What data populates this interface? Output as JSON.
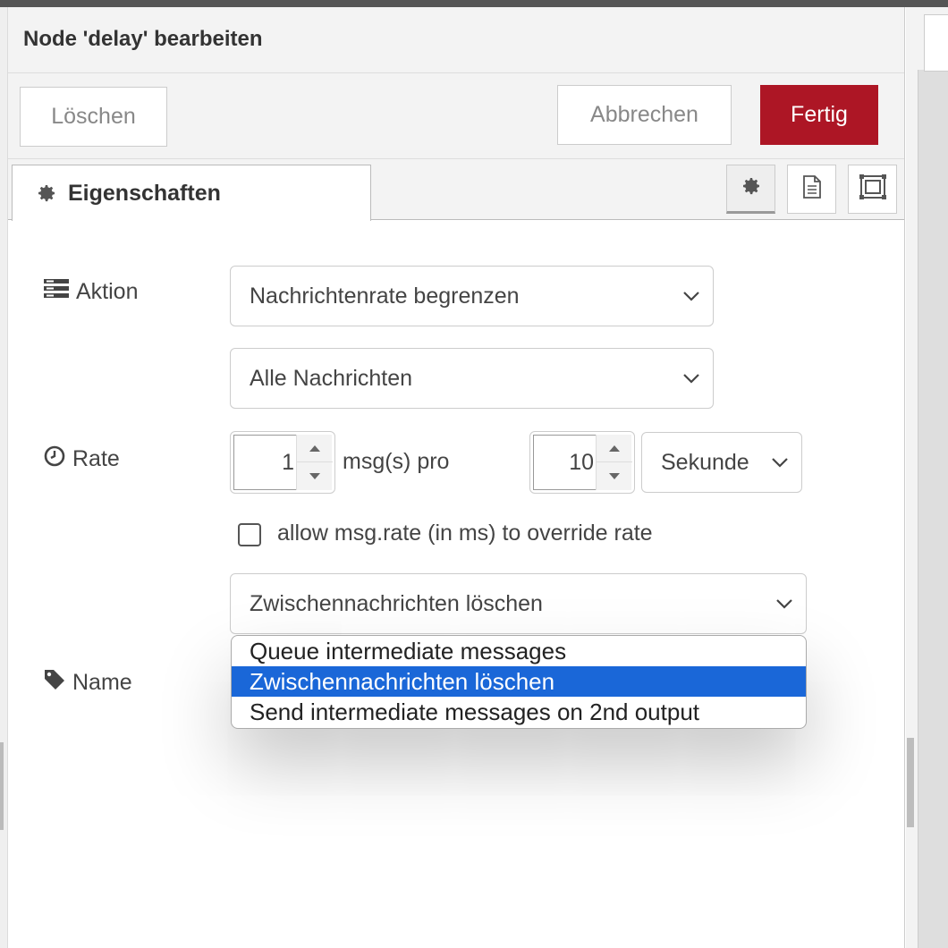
{
  "dialog": {
    "title": "Node 'delay' bearbeiten",
    "buttons": {
      "delete": "Löschen",
      "cancel": "Abbrechen",
      "done": "Fertig"
    },
    "accent_color": "#ad1625"
  },
  "tabs": {
    "properties_label": "Eigenschaften",
    "icons": [
      "gear-icon",
      "description-icon",
      "appearance-icon"
    ]
  },
  "form": {
    "action": {
      "label": "Aktion",
      "selected": "Nachrichtenrate begrenzen",
      "scope_selected": "Alle Nachrichten"
    },
    "rate": {
      "label": "Rate",
      "count": "1",
      "per_label": "msg(s) pro",
      "interval": "10",
      "unit_selected": "Sekunde"
    },
    "override_label": "allow msg.rate (in ms) to override rate",
    "override_checked": false,
    "drop_mode": {
      "selected": "Zwischennachrichten löschen",
      "options": [
        "Queue intermediate messages",
        "Zwischennachrichten löschen",
        "Send intermediate messages on 2nd output"
      ],
      "highlight_color": "#1a67d8"
    },
    "name": {
      "label": "Name"
    }
  }
}
